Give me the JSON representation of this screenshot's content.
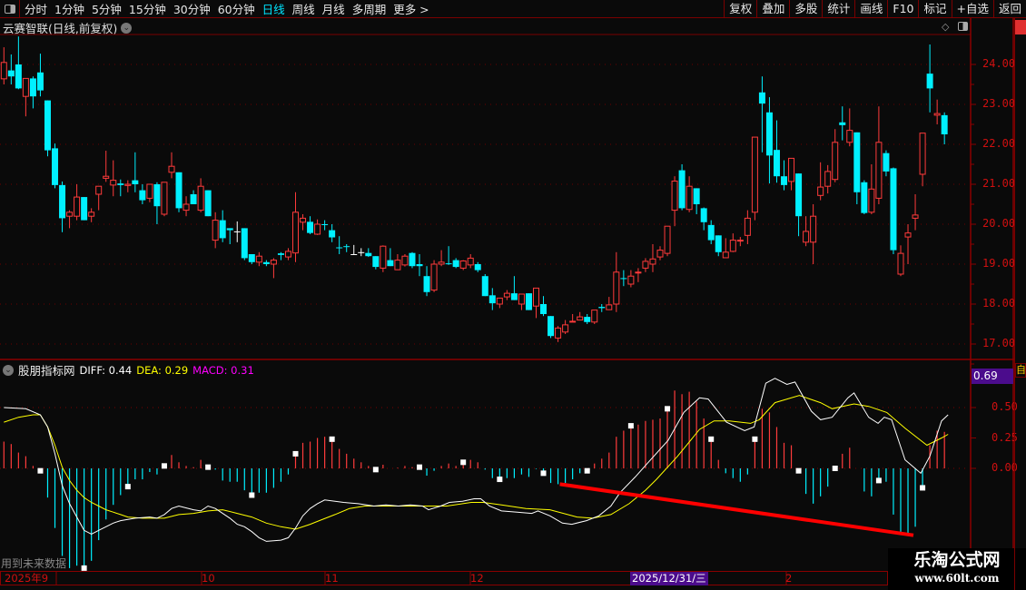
{
  "toolbar": {
    "periods": [
      "分时",
      "1分钟",
      "5分钟",
      "15分钟",
      "30分钟",
      "60分钟",
      "日线",
      "周线",
      "月线",
      "多周期",
      "更多 >"
    ],
    "active": "日线",
    "actions": [
      "复权",
      "叠加",
      "多股",
      "统计",
      "画线",
      "F10",
      "标记",
      "+自选",
      "返回"
    ]
  },
  "stock_title": "云赛智联(日线,前复权)",
  "indicator": {
    "name": "股朋指标网",
    "diff_label": "DIFF: 0.44",
    "dea_label": "DEA: 0.29",
    "macd_label": "MACD: 0.31",
    "current_value": "0.69"
  },
  "future_note": "用到未来数据",
  "colors": {
    "up": "#ff3b3b",
    "down": "#00f0ff",
    "diff": "#ffffff",
    "dea": "#ffff00",
    "macd_label": "#ff00ff",
    "trend": "#ff0000"
  },
  "price_axis": [
    "24.00",
    "23.00",
    "22.00",
    "21.00",
    "20.00",
    "19.00",
    "18.00",
    "17.00"
  ],
  "ind_axis": [
    "0.50",
    "0.25",
    "0.00"
  ],
  "date_axis": {
    "labels": [
      "2025年9",
      "10",
      "11",
      "12",
      "2"
    ],
    "highlight": "2025/12/31/三"
  },
  "watermark": {
    "name": "乐淘公式网",
    "url": "www.60lt.com"
  },
  "side_tab": "自",
  "chart_data": {
    "type": "candlestick",
    "ylim": [
      16.8,
      24.8
    ],
    "candles": [
      [
        23.64,
        24.43,
        23.5,
        24.05
      ],
      [
        23.85,
        24.25,
        23.5,
        23.7
      ],
      [
        24.0,
        24.7,
        23.38,
        23.4
      ],
      [
        23.2,
        23.65,
        22.7,
        23.65
      ],
      [
        23.65,
        23.7,
        22.9,
        23.2
      ],
      [
        23.8,
        24.27,
        23.2,
        23.35
      ],
      [
        23.1,
        23.1,
        21.7,
        21.85
      ],
      [
        21.9,
        22.02,
        20.9,
        20.98
      ],
      [
        20.98,
        21.07,
        19.8,
        20.15
      ],
      [
        20.2,
        20.35,
        19.9,
        20.3
      ],
      [
        20.2,
        21.0,
        20.1,
        20.68
      ],
      [
        20.68,
        20.68,
        20.1,
        20.1
      ],
      [
        20.2,
        20.4,
        20.05,
        20.3
      ],
      [
        20.75,
        20.95,
        20.35,
        20.95
      ],
      [
        21.15,
        21.84,
        21.06,
        21.2
      ],
      [
        20.98,
        21.6,
        20.7,
        21.1
      ],
      [
        21.02,
        21.12,
        20.7,
        20.98
      ],
      [
        20.97,
        21.1,
        20.8,
        21.0
      ],
      [
        21.1,
        21.8,
        20.8,
        21.0
      ],
      [
        20.85,
        21.0,
        20.5,
        20.6
      ],
      [
        20.65,
        21.0,
        20.55,
        21.0
      ],
      [
        21.0,
        21.05,
        20.0,
        20.45
      ],
      [
        20.25,
        21.05,
        20.2,
        21.05
      ],
      [
        21.3,
        21.8,
        21.15,
        21.45
      ],
      [
        21.3,
        21.3,
        20.3,
        20.4
      ],
      [
        20.35,
        20.7,
        20.2,
        20.5
      ],
      [
        20.75,
        20.85,
        20.5,
        20.5
      ],
      [
        20.35,
        21.15,
        20.3,
        20.95
      ],
      [
        20.85,
        20.85,
        20.2,
        20.2
      ],
      [
        19.6,
        20.3,
        19.4,
        20.1
      ],
      [
        20.1,
        20.35,
        19.55,
        19.65
      ],
      [
        19.9,
        19.9,
        19.5,
        19.85
      ],
      [
        19.82,
        20.07,
        19.55,
        19.82
      ],
      [
        19.9,
        19.9,
        19.1,
        19.15
      ],
      [
        19.25,
        19.25,
        19.0,
        19.05
      ],
      [
        19.05,
        19.3,
        18.95,
        19.2
      ],
      [
        19.05,
        19.1,
        18.95,
        19.0
      ],
      [
        19.0,
        19.15,
        18.65,
        19.1
      ],
      [
        19.27,
        19.3,
        19.1,
        19.23
      ],
      [
        19.18,
        19.4,
        19.1,
        19.32
      ],
      [
        19.28,
        20.8,
        19.05,
        20.3
      ],
      [
        20.05,
        20.25,
        19.85,
        20.15
      ],
      [
        20.06,
        20.2,
        19.75,
        19.78
      ],
      [
        19.75,
        20.12,
        19.73,
        20.0
      ],
      [
        20.0,
        20.1,
        19.85,
        19.98
      ],
      [
        19.85,
        20.0,
        19.55,
        19.67
      ],
      [
        19.42,
        19.7,
        19.25,
        19.4
      ],
      [
        19.45,
        19.5,
        19.3,
        19.43
      ],
      [
        19.25,
        19.48,
        19.25,
        19.25
      ],
      [
        19.3,
        19.4,
        19.2,
        19.3
      ],
      [
        19.28,
        19.4,
        19.18,
        19.2
      ],
      [
        19.2,
        19.2,
        18.87,
        18.93
      ],
      [
        18.9,
        19.47,
        18.8,
        19.45
      ],
      [
        19.1,
        19.4,
        18.95,
        18.95
      ],
      [
        18.86,
        19.25,
        18.85,
        19.1
      ],
      [
        18.98,
        19.25,
        18.94,
        19.2
      ],
      [
        19.28,
        19.3,
        18.9,
        18.95
      ],
      [
        19.0,
        19.25,
        18.7,
        18.95
      ],
      [
        18.7,
        18.95,
        18.2,
        18.3
      ],
      [
        18.35,
        19.1,
        18.3,
        19.0
      ],
      [
        19.0,
        19.35,
        18.95,
        19.05
      ],
      [
        19.02,
        19.45,
        18.98,
        19.0
      ],
      [
        19.1,
        19.15,
        18.9,
        18.93
      ],
      [
        18.9,
        19.1,
        18.85,
        19.08
      ],
      [
        18.98,
        19.25,
        18.9,
        19.15
      ],
      [
        19.0,
        19.05,
        18.8,
        18.85
      ],
      [
        18.7,
        18.75,
        18.2,
        18.2
      ],
      [
        18.22,
        18.4,
        17.85,
        18.02
      ],
      [
        18.0,
        18.15,
        17.9,
        18.15
      ],
      [
        18.18,
        18.35,
        18.1,
        18.27
      ],
      [
        18.27,
        18.7,
        18.1,
        18.1
      ],
      [
        18.0,
        18.25,
        17.85,
        18.25
      ],
      [
        18.27,
        18.27,
        17.85,
        17.85
      ],
      [
        17.95,
        18.4,
        17.65,
        18.4
      ],
      [
        18.0,
        18.2,
        17.7,
        17.75
      ],
      [
        17.7,
        17.7,
        17.15,
        17.2
      ],
      [
        17.15,
        17.45,
        17.05,
        17.4
      ],
      [
        17.3,
        17.6,
        17.25,
        17.48
      ],
      [
        17.55,
        17.75,
        17.55,
        17.57
      ],
      [
        17.6,
        17.8,
        17.6,
        17.68
      ],
      [
        17.68,
        17.75,
        17.5,
        17.55
      ],
      [
        17.55,
        17.85,
        17.5,
        17.85
      ],
      [
        17.93,
        18.0,
        17.8,
        17.9
      ],
      [
        17.86,
        18.18,
        17.85,
        17.98
      ],
      [
        18.0,
        19.3,
        17.8,
        18.8
      ],
      [
        18.65,
        18.85,
        18.45,
        18.63
      ],
      [
        18.5,
        18.85,
        18.42,
        18.7
      ],
      [
        18.78,
        18.9,
        18.55,
        18.8
      ],
      [
        18.9,
        19.15,
        18.8,
        19.07
      ],
      [
        19.0,
        19.5,
        18.8,
        19.13
      ],
      [
        19.18,
        19.45,
        19.1,
        19.35
      ],
      [
        19.27,
        19.95,
        19.2,
        19.95
      ],
      [
        20.35,
        21.2,
        19.95,
        21.08
      ],
      [
        21.35,
        21.5,
        20.35,
        20.4
      ],
      [
        20.37,
        21.2,
        20.3,
        20.95
      ],
      [
        20.9,
        20.9,
        20.25,
        20.5
      ],
      [
        20.4,
        20.42,
        19.85,
        20.05
      ],
      [
        19.98,
        20.1,
        19.5,
        19.6
      ],
      [
        19.72,
        19.72,
        19.2,
        19.3
      ],
      [
        19.16,
        19.65,
        19.16,
        19.3
      ],
      [
        19.32,
        19.77,
        19.3,
        19.6
      ],
      [
        19.58,
        19.68,
        19.45,
        19.6
      ],
      [
        19.72,
        20.35,
        19.5,
        20.15
      ],
      [
        20.3,
        22.18,
        20.1,
        22.18
      ],
      [
        23.3,
        23.7,
        21.8,
        23.02
      ],
      [
        22.8,
        23.18,
        21.02,
        21.72
      ],
      [
        21.86,
        22.6,
        21.04,
        21.2
      ],
      [
        21.2,
        21.6,
        20.85,
        20.98
      ],
      [
        21.07,
        21.65,
        20.85,
        21.65
      ],
      [
        21.27,
        21.27,
        19.7,
        20.2
      ],
      [
        19.55,
        20.2,
        19.45,
        19.82
      ],
      [
        19.55,
        20.5,
        19.0,
        20.2
      ],
      [
        20.72,
        21.55,
        20.6,
        20.93
      ],
      [
        20.95,
        21.48,
        20.77,
        21.32
      ],
      [
        21.12,
        22.38,
        21.05,
        22.05
      ],
      [
        22.55,
        22.95,
        22.1,
        22.48
      ],
      [
        22.05,
        22.9,
        21.95,
        22.35
      ],
      [
        22.3,
        22.3,
        20.5,
        20.8
      ],
      [
        21.05,
        21.1,
        20.25,
        20.28
      ],
      [
        20.3,
        21.5,
        20.25,
        20.88
      ],
      [
        20.65,
        22.95,
        20.5,
        22.05
      ],
      [
        21.78,
        21.85,
        21.2,
        21.32
      ],
      [
        21.4,
        21.42,
        19.25,
        19.35
      ],
      [
        18.75,
        19.47,
        18.7,
        19.27
      ],
      [
        19.68,
        20.0,
        19.0,
        19.78
      ],
      [
        20.15,
        20.75,
        19.85,
        20.23
      ],
      [
        21.25,
        22.28,
        20.95,
        22.28
      ],
      [
        23.77,
        24.5,
        22.8,
        23.4
      ],
      [
        22.73,
        23.12,
        22.5,
        22.77
      ],
      [
        22.73,
        22.8,
        22.0,
        22.25
      ]
    ],
    "indicator_ylim": [
      -0.85,
      0.75
    ],
    "macd_bars": [
      0.22,
      0.2,
      0.13,
      0.1,
      0.02,
      -0.02,
      -0.24,
      -0.49,
      -0.72,
      -0.82,
      -0.8,
      -0.82,
      -0.76,
      -0.59,
      -0.42,
      -0.3,
      -0.22,
      -0.15,
      -0.09,
      -0.09,
      -0.03,
      -0.05,
      0.02,
      0.11,
      0.05,
      0.02,
      0.01,
      0.07,
      0.01,
      -0.01,
      -0.1,
      -0.11,
      -0.11,
      -0.18,
      -0.22,
      -0.2,
      -0.2,
      -0.16,
      -0.11,
      -0.05,
      0.12,
      0.21,
      0.22,
      0.25,
      0.26,
      0.24,
      0.16,
      0.12,
      0.08,
      0.05,
      0.02,
      -0.01,
      0.03,
      0.0,
      0.005,
      0.02,
      0.01,
      0.01,
      -0.06,
      -0.02,
      0.02,
      0.04,
      0.02,
      0.05,
      0.07,
      0.05,
      -0.01,
      -0.08,
      -0.09,
      -0.08,
      -0.08,
      -0.05,
      -0.07,
      -0.005,
      -0.04,
      -0.12,
      -0.13,
      -0.12,
      -0.09,
      -0.04,
      -0.02,
      0.04,
      0.08,
      0.13,
      0.26,
      0.31,
      0.35,
      0.36,
      0.39,
      0.4,
      0.41,
      0.49,
      0.64,
      0.61,
      0.63,
      0.55,
      0.41,
      0.24,
      0.07,
      -0.04,
      -0.08,
      -0.11,
      -0.05,
      0.24,
      0.49,
      0.46,
      0.34,
      0.21,
      0.19,
      -0.02,
      -0.21,
      -0.29,
      -0.23,
      -0.15,
      0.0,
      0.12,
      0.17,
      0.0,
      -0.19,
      -0.23,
      -0.1,
      -0.11,
      -0.38,
      -0.53,
      -0.54,
      -0.48,
      -0.16,
      0.19,
      0.31,
      0.3
    ],
    "marker_indices": [
      5,
      11,
      17,
      22,
      28,
      34,
      40,
      45,
      51,
      57,
      63,
      68,
      74,
      80,
      86,
      91,
      97,
      103,
      109,
      114,
      120,
      126
    ],
    "diff": [
      [
        0,
        0.5
      ],
      [
        3,
        0.49
      ],
      [
        5,
        0.44
      ],
      [
        6,
        0.34
      ],
      [
        7,
        0.12
      ],
      [
        8,
        -0.14
      ],
      [
        9,
        -0.29
      ],
      [
        10,
        -0.4
      ],
      [
        11,
        -0.51
      ],
      [
        12,
        -0.54
      ],
      [
        13,
        -0.51
      ],
      [
        14,
        -0.48
      ],
      [
        15,
        -0.45
      ],
      [
        16,
        -0.43
      ],
      [
        17,
        -0.42
      ],
      [
        18,
        -0.41
      ],
      [
        20,
        -0.4
      ],
      [
        21,
        -0.41
      ],
      [
        22,
        -0.38
      ],
      [
        23,
        -0.33
      ],
      [
        24,
        -0.31
      ],
      [
        26,
        -0.34
      ],
      [
        27,
        -0.35
      ],
      [
        28,
        -0.31
      ],
      [
        29,
        -0.33
      ],
      [
        30,
        -0.37
      ],
      [
        31,
        -0.41
      ],
      [
        32,
        -0.46
      ],
      [
        33,
        -0.48
      ],
      [
        34,
        -0.52
      ],
      [
        35,
        -0.57
      ],
      [
        36,
        -0.6
      ],
      [
        38,
        -0.59
      ],
      [
        39,
        -0.57
      ],
      [
        40,
        -0.49
      ],
      [
        41,
        -0.39
      ],
      [
        42,
        -0.33
      ],
      [
        43,
        -0.29
      ],
      [
        44,
        -0.26
      ],
      [
        46.6,
        -0.28
      ],
      [
        48.6,
        -0.29
      ],
      [
        50.75,
        -0.31
      ],
      [
        52.4,
        -0.3
      ],
      [
        54.1,
        -0.31
      ],
      [
        55.75,
        -0.3
      ],
      [
        57.4,
        -0.31
      ],
      [
        58.25,
        -0.34
      ],
      [
        59.9,
        -0.31
      ],
      [
        61.1,
        -0.28
      ],
      [
        62.9,
        -0.27
      ],
      [
        64.5,
        -0.25
      ],
      [
        65.4,
        -0.25
      ],
      [
        66.6,
        -0.31
      ],
      [
        68.25,
        -0.35
      ],
      [
        70.4,
        -0.36
      ],
      [
        72.4,
        -0.37
      ],
      [
        73.25,
        -0.35
      ],
      [
        74.9,
        -0.39
      ],
      [
        76.6,
        -0.45
      ],
      [
        77.9,
        -0.46
      ],
      [
        79.9,
        -0.43
      ],
      [
        81.6,
        -0.39
      ],
      [
        83.25,
        -0.31
      ],
      [
        84.5,
        -0.2
      ],
      [
        86.6,
        -0.07
      ],
      [
        88.25,
        0.04
      ],
      [
        91.1,
        0.23
      ],
      [
        93.25,
        0.46
      ],
      [
        95.4,
        0.58
      ],
      [
        96.6,
        0.57
      ],
      [
        99.1,
        0.38
      ],
      [
        101.6,
        0.31
      ],
      [
        102.9,
        0.34
      ],
      [
        104.5,
        0.7
      ],
      [
        105.75,
        0.74
      ],
      [
        107.4,
        0.69
      ],
      [
        108.5,
        0.71
      ],
      [
        110.75,
        0.47
      ],
      [
        112,
        0.4
      ],
      [
        113.6,
        0.42
      ],
      [
        115.75,
        0.58
      ],
      [
        116.6,
        0.62
      ],
      [
        118.6,
        0.42
      ],
      [
        119.9,
        0.37
      ],
      [
        120.75,
        0.42
      ],
      [
        121.75,
        0.4
      ],
      [
        123.6,
        0.07
      ],
      [
        125.75,
        -0.04
      ],
      [
        127,
        0.1
      ],
      [
        128.6,
        0.39
      ],
      [
        129.5,
        0.44
      ]
    ],
    "dea": [
      [
        0,
        0.38
      ],
      [
        2,
        0.42
      ],
      [
        4,
        0.44
      ],
      [
        5,
        0.44
      ],
      [
        6,
        0.34
      ],
      [
        7,
        0.19
      ],
      [
        8,
        0.01
      ],
      [
        9,
        -0.1
      ],
      [
        10,
        -0.18
      ],
      [
        11,
        -0.24
      ],
      [
        12,
        -0.28
      ],
      [
        13,
        -0.31
      ],
      [
        14,
        -0.34
      ],
      [
        15,
        -0.36
      ],
      [
        16,
        -0.38
      ],
      [
        17,
        -0.4
      ],
      [
        19,
        -0.41
      ],
      [
        22,
        -0.41
      ],
      [
        24,
        -0.38
      ],
      [
        26,
        -0.37
      ],
      [
        28,
        -0.35
      ],
      [
        30,
        -0.34
      ],
      [
        32,
        -0.37
      ],
      [
        34,
        -0.4
      ],
      [
        36,
        -0.45
      ],
      [
        38,
        -0.48
      ],
      [
        40,
        -0.5
      ],
      [
        42,
        -0.46
      ],
      [
        43.25,
        -0.43
      ],
      [
        45.4,
        -0.38
      ],
      [
        47.4,
        -0.33
      ],
      [
        49.5,
        -0.31
      ],
      [
        53.6,
        -0.31
      ],
      [
        60.75,
        -0.31
      ],
      [
        64.1,
        -0.28
      ],
      [
        65.75,
        -0.28
      ],
      [
        68.25,
        -0.3
      ],
      [
        71.6,
        -0.33
      ],
      [
        74.9,
        -0.34
      ],
      [
        78.6,
        -0.4
      ],
      [
        80.75,
        -0.41
      ],
      [
        83.25,
        -0.38
      ],
      [
        85.75,
        -0.29
      ],
      [
        88,
        -0.18
      ],
      [
        89.5,
        -0.09
      ],
      [
        92.4,
        0.1
      ],
      [
        95.4,
        0.32
      ],
      [
        97.4,
        0.39
      ],
      [
        99.5,
        0.39
      ],
      [
        102.4,
        0.37
      ],
      [
        103.6,
        0.4
      ],
      [
        105.75,
        0.54
      ],
      [
        109.1,
        0.6
      ],
      [
        112,
        0.54
      ],
      [
        113.6,
        0.49
      ],
      [
        116.6,
        0.53
      ],
      [
        118.6,
        0.51
      ],
      [
        121.1,
        0.46
      ],
      [
        123.6,
        0.33
      ],
      [
        126.6,
        0.19
      ],
      [
        128.6,
        0.25
      ],
      [
        129.5,
        0.28
      ]
    ],
    "trend_line": [
      [
        76.25,
        -0.13
      ],
      [
        124.75,
        -0.55
      ]
    ]
  }
}
